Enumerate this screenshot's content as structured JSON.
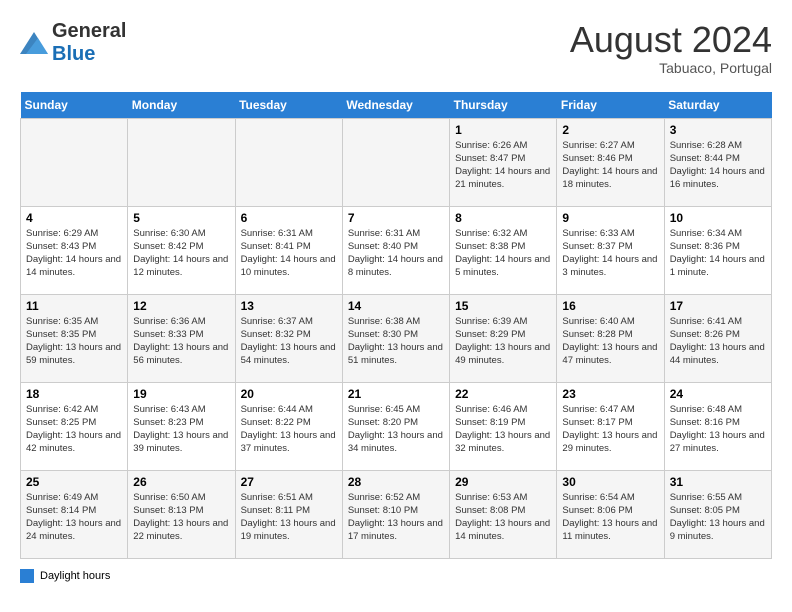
{
  "logo": {
    "general": "General",
    "blue": "Blue"
  },
  "title": "August 2024",
  "subtitle": "Tabuaco, Portugal",
  "days_of_week": [
    "Sunday",
    "Monday",
    "Tuesday",
    "Wednesday",
    "Thursday",
    "Friday",
    "Saturday"
  ],
  "legend_label": "Daylight hours",
  "weeks": [
    [
      {
        "day": "",
        "info": ""
      },
      {
        "day": "",
        "info": ""
      },
      {
        "day": "",
        "info": ""
      },
      {
        "day": "",
        "info": ""
      },
      {
        "day": "1",
        "info": "Sunrise: 6:26 AM\nSunset: 8:47 PM\nDaylight: 14 hours and 21 minutes."
      },
      {
        "day": "2",
        "info": "Sunrise: 6:27 AM\nSunset: 8:46 PM\nDaylight: 14 hours and 18 minutes."
      },
      {
        "day": "3",
        "info": "Sunrise: 6:28 AM\nSunset: 8:44 PM\nDaylight: 14 hours and 16 minutes."
      }
    ],
    [
      {
        "day": "4",
        "info": "Sunrise: 6:29 AM\nSunset: 8:43 PM\nDaylight: 14 hours and 14 minutes."
      },
      {
        "day": "5",
        "info": "Sunrise: 6:30 AM\nSunset: 8:42 PM\nDaylight: 14 hours and 12 minutes."
      },
      {
        "day": "6",
        "info": "Sunrise: 6:31 AM\nSunset: 8:41 PM\nDaylight: 14 hours and 10 minutes."
      },
      {
        "day": "7",
        "info": "Sunrise: 6:31 AM\nSunset: 8:40 PM\nDaylight: 14 hours and 8 minutes."
      },
      {
        "day": "8",
        "info": "Sunrise: 6:32 AM\nSunset: 8:38 PM\nDaylight: 14 hours and 5 minutes."
      },
      {
        "day": "9",
        "info": "Sunrise: 6:33 AM\nSunset: 8:37 PM\nDaylight: 14 hours and 3 minutes."
      },
      {
        "day": "10",
        "info": "Sunrise: 6:34 AM\nSunset: 8:36 PM\nDaylight: 14 hours and 1 minute."
      }
    ],
    [
      {
        "day": "11",
        "info": "Sunrise: 6:35 AM\nSunset: 8:35 PM\nDaylight: 13 hours and 59 minutes."
      },
      {
        "day": "12",
        "info": "Sunrise: 6:36 AM\nSunset: 8:33 PM\nDaylight: 13 hours and 56 minutes."
      },
      {
        "day": "13",
        "info": "Sunrise: 6:37 AM\nSunset: 8:32 PM\nDaylight: 13 hours and 54 minutes."
      },
      {
        "day": "14",
        "info": "Sunrise: 6:38 AM\nSunset: 8:30 PM\nDaylight: 13 hours and 51 minutes."
      },
      {
        "day": "15",
        "info": "Sunrise: 6:39 AM\nSunset: 8:29 PM\nDaylight: 13 hours and 49 minutes."
      },
      {
        "day": "16",
        "info": "Sunrise: 6:40 AM\nSunset: 8:28 PM\nDaylight: 13 hours and 47 minutes."
      },
      {
        "day": "17",
        "info": "Sunrise: 6:41 AM\nSunset: 8:26 PM\nDaylight: 13 hours and 44 minutes."
      }
    ],
    [
      {
        "day": "18",
        "info": "Sunrise: 6:42 AM\nSunset: 8:25 PM\nDaylight: 13 hours and 42 minutes."
      },
      {
        "day": "19",
        "info": "Sunrise: 6:43 AM\nSunset: 8:23 PM\nDaylight: 13 hours and 39 minutes."
      },
      {
        "day": "20",
        "info": "Sunrise: 6:44 AM\nSunset: 8:22 PM\nDaylight: 13 hours and 37 minutes."
      },
      {
        "day": "21",
        "info": "Sunrise: 6:45 AM\nSunset: 8:20 PM\nDaylight: 13 hours and 34 minutes."
      },
      {
        "day": "22",
        "info": "Sunrise: 6:46 AM\nSunset: 8:19 PM\nDaylight: 13 hours and 32 minutes."
      },
      {
        "day": "23",
        "info": "Sunrise: 6:47 AM\nSunset: 8:17 PM\nDaylight: 13 hours and 29 minutes."
      },
      {
        "day": "24",
        "info": "Sunrise: 6:48 AM\nSunset: 8:16 PM\nDaylight: 13 hours and 27 minutes."
      }
    ],
    [
      {
        "day": "25",
        "info": "Sunrise: 6:49 AM\nSunset: 8:14 PM\nDaylight: 13 hours and 24 minutes."
      },
      {
        "day": "26",
        "info": "Sunrise: 6:50 AM\nSunset: 8:13 PM\nDaylight: 13 hours and 22 minutes."
      },
      {
        "day": "27",
        "info": "Sunrise: 6:51 AM\nSunset: 8:11 PM\nDaylight: 13 hours and 19 minutes."
      },
      {
        "day": "28",
        "info": "Sunrise: 6:52 AM\nSunset: 8:10 PM\nDaylight: 13 hours and 17 minutes."
      },
      {
        "day": "29",
        "info": "Sunrise: 6:53 AM\nSunset: 8:08 PM\nDaylight: 13 hours and 14 minutes."
      },
      {
        "day": "30",
        "info": "Sunrise: 6:54 AM\nSunset: 8:06 PM\nDaylight: 13 hours and 11 minutes."
      },
      {
        "day": "31",
        "info": "Sunrise: 6:55 AM\nSunset: 8:05 PM\nDaylight: 13 hours and 9 minutes."
      }
    ]
  ]
}
